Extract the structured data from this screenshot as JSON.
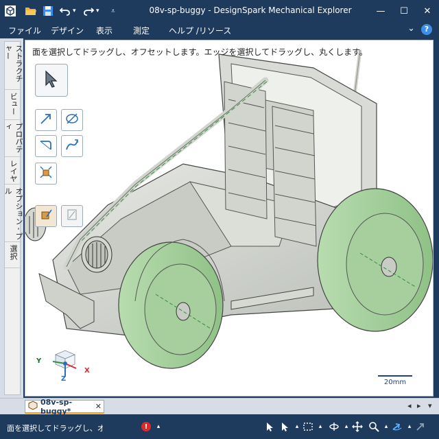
{
  "window": {
    "title": "08v-sp-buggy - DesignSpark Mechanical Explorer",
    "minimize_label": "—",
    "restore_label": "☐",
    "close_label": "✕"
  },
  "menu": {
    "items": [
      "ファイル",
      "デザイン",
      "表示",
      "測定",
      "ヘルプ /リソース"
    ],
    "collapse_label": "⌄",
    "help_label": "?"
  },
  "side_tabs": [
    "ストラクチャー",
    "ビュー",
    "プロパティ",
    "レイヤ",
    "オプション - プル",
    "選択"
  ],
  "viewport": {
    "hint": "面を選択してドラッグし、オフセットします。エッジを選択してドラッグし、丸くします。",
    "tools": [
      "select-tool",
      "pull-tool",
      "move-tool",
      "fillet-tool",
      "sweep-tool",
      "scale-tool"
    ],
    "triad": {
      "x": "X",
      "y": "Y",
      "z": "Z"
    },
    "scale_label": "20mm"
  },
  "doc_tab": {
    "label": "08v-sp-buggy*",
    "close": "✕",
    "nav_prev": "◂",
    "nav_next": "▸",
    "nav_more": "▾"
  },
  "status": {
    "text": "面を選択してドラッグし、オ",
    "error_badge": "!",
    "accent": "#1e3a5c",
    "error_color": "#d92b2b"
  }
}
